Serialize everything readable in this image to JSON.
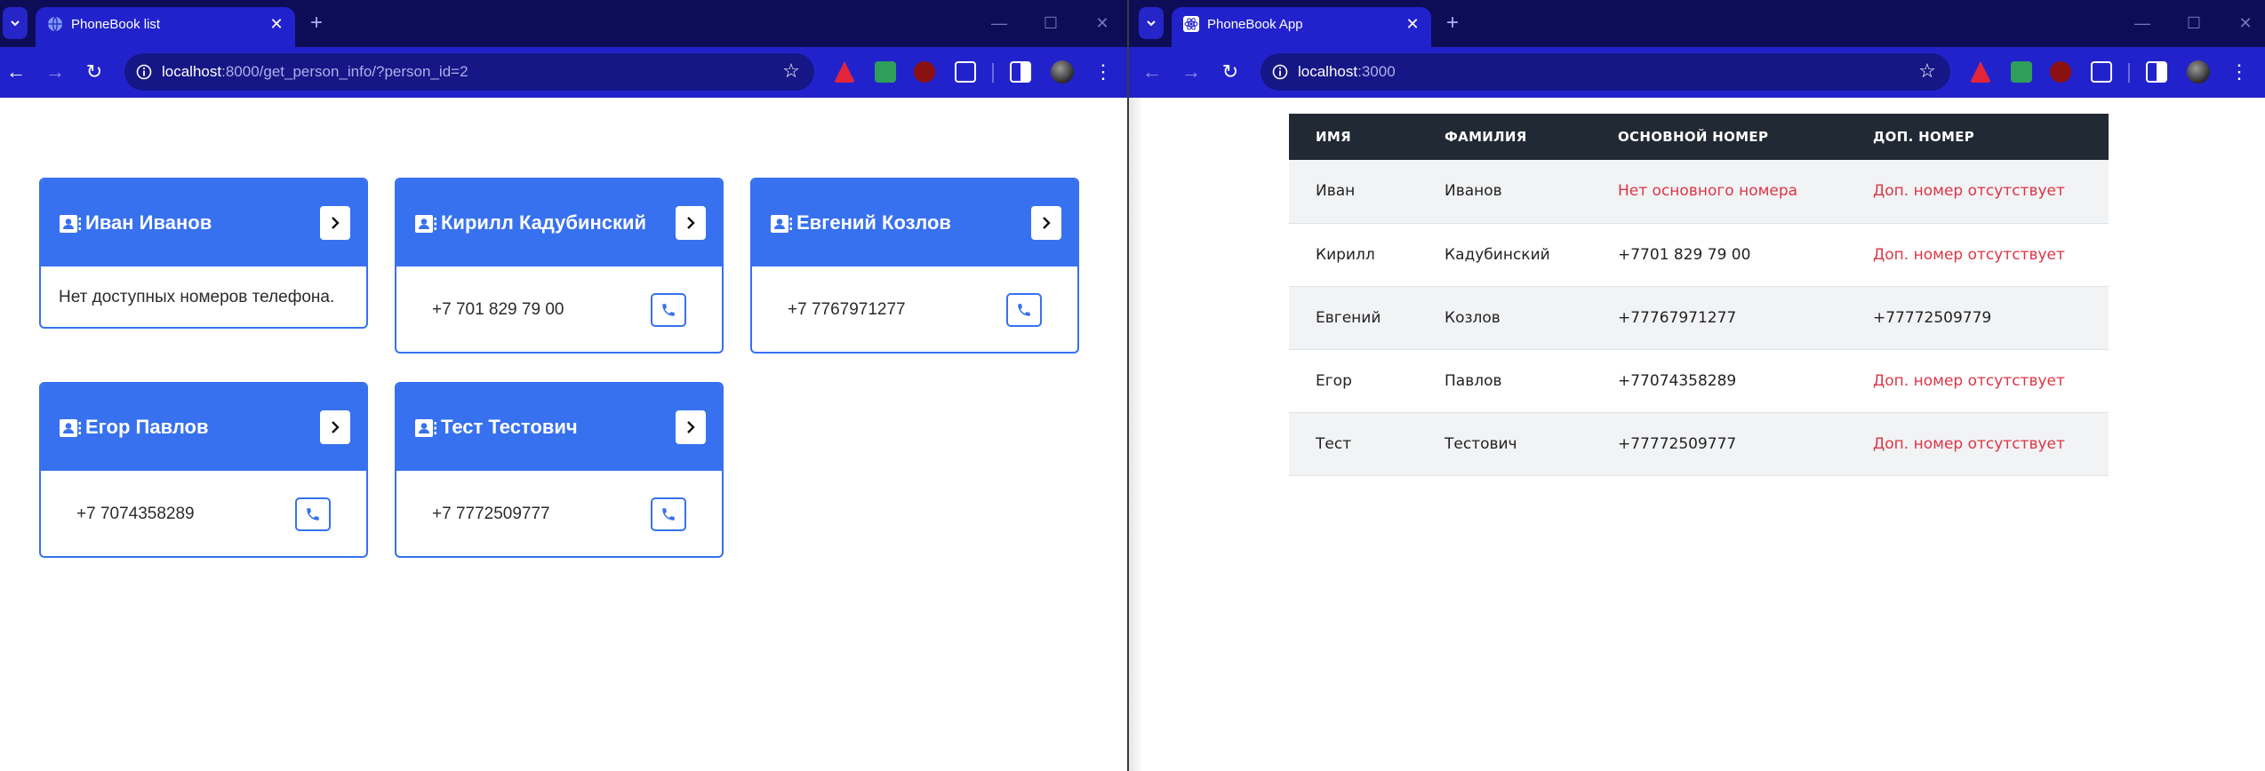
{
  "left_window": {
    "tab_title": "PhoneBook list",
    "url_host": "localhost",
    "url_rest": ":8000/get_person_info/?person_id=2",
    "contacts": [
      {
        "name": "Иван Иванов",
        "empty_text": "Нет доступных номеров телефона."
      },
      {
        "name": "Кирилл Кадубинский",
        "phone": "+7 701 829 79 00"
      },
      {
        "name": "Евгений Козлов",
        "phone": "+7 7767971277"
      },
      {
        "name": "Егор Павлов",
        "phone": "+7 7074358289"
      },
      {
        "name": "Тест Тестович",
        "phone": "+7 7772509777"
      }
    ]
  },
  "right_window": {
    "tab_title": "PhoneBook App",
    "url_host": "localhost",
    "url_rest": ":3000",
    "table": {
      "headers": [
        "ИМЯ",
        "ФАМИЛИЯ",
        "ОСНОВНОЙ НОМЕР",
        "ДОП. НОМЕР"
      ],
      "rows": [
        {
          "first": "Иван",
          "last": "Иванов",
          "main": "Нет основного номера",
          "extra": "Доп. номер отсутствует"
        },
        {
          "first": "Кирилл",
          "last": "Кадубинский",
          "main": "+7701 829 79 00",
          "extra": "Доп. номер отсутствует"
        },
        {
          "first": "Евгений",
          "last": "Козлов",
          "main": "+77767971277",
          "extra": "+77772509779"
        },
        {
          "first": "Егор",
          "last": "Павлов",
          "main": "+77074358289",
          "extra": "Доп. номер отсутствует"
        },
        {
          "first": "Тест",
          "last": "Тестович",
          "main": "+77772509777",
          "extra": "Доп. номер отсутствует"
        }
      ]
    }
  },
  "colors": {
    "tabbar": "#0d0d57",
    "toolbar": "#2222cc",
    "card_primary": "#3771ef",
    "table_header": "#212934",
    "missing_text": "#dc3545"
  },
  "icons": {
    "tab_dropdown": "chevron-down-icon",
    "left_favicon": "globe-icon",
    "right_favicon": "react-icon",
    "card_header": "contact-card-icon",
    "card_action": "chevron-right-icon",
    "call": "phone-icon"
  }
}
